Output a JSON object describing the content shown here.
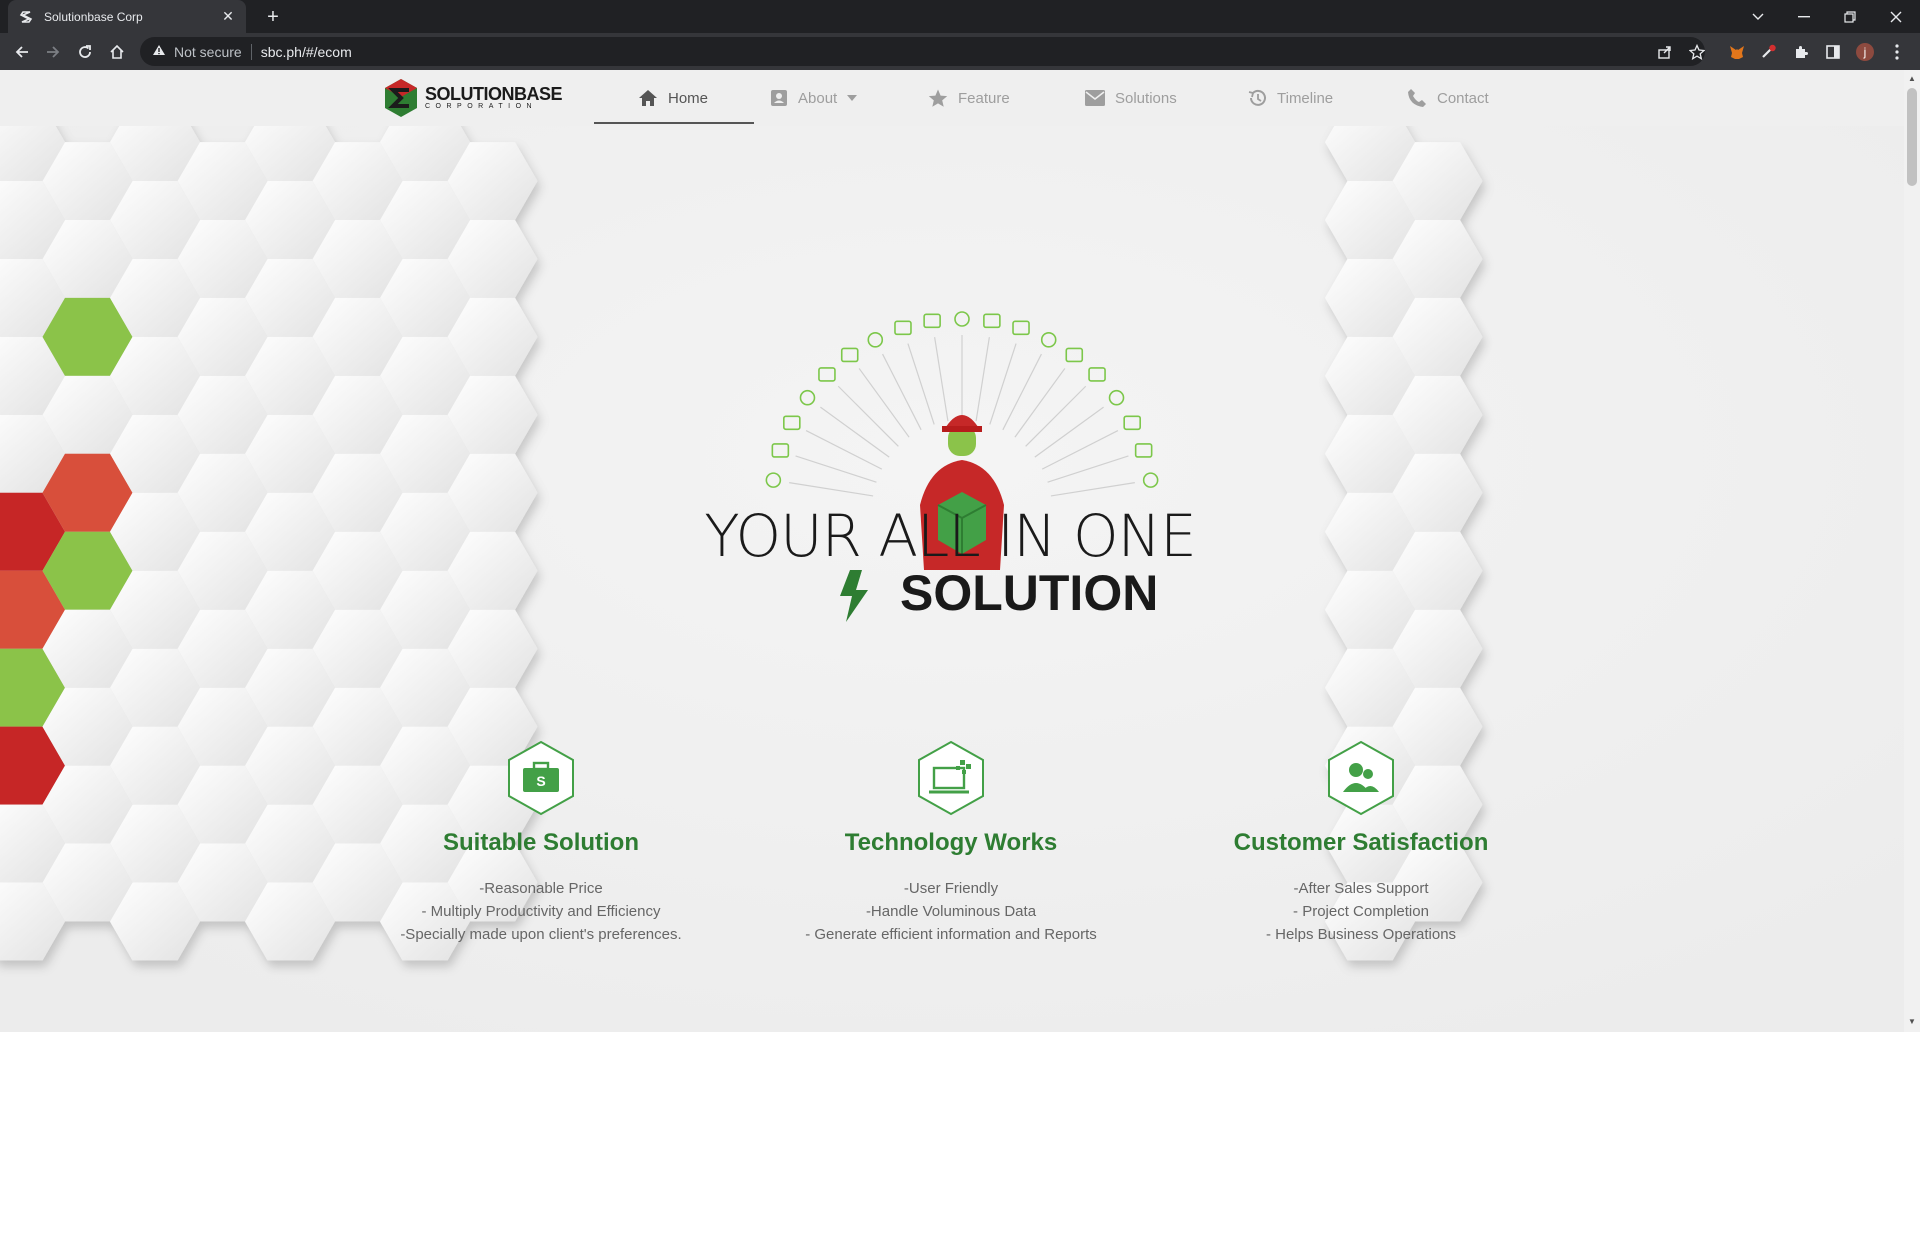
{
  "browser": {
    "tab_title": "Solutionbase Corp",
    "tab_close": "✕",
    "new_tab": "+",
    "security_label": "Not secure",
    "url": "sbc.ph/#/ecom",
    "profile_initial": "j"
  },
  "nav": {
    "logo_brand": "SOLUTIONBASE",
    "logo_sub": "CORPORATION",
    "items": [
      {
        "label": "Home"
      },
      {
        "label": "About"
      },
      {
        "label": "Feature"
      },
      {
        "label": "Solutions"
      },
      {
        "label": "Timeline"
      },
      {
        "label": "Contact"
      }
    ]
  },
  "hero": {
    "line1": "YOUR ALL IN ONE",
    "line2": "SOLUTION"
  },
  "features": [
    {
      "title": "Suitable Solution",
      "lines": [
        "-Reasonable Price",
        "- Multiply Productivity and Efficiency",
        "-Specially made upon client's preferences."
      ]
    },
    {
      "title": "Technology Works",
      "lines": [
        "-User Friendly",
        "-Handle Voluminous Data",
        "- Generate efficient information and Reports"
      ]
    },
    {
      "title": "Customer Satisfaction",
      "lines": [
        "-After Sales Support",
        "- Project Completion",
        "- Helps Business Operations"
      ]
    }
  ],
  "colors": {
    "accent_green": "#2e7d32",
    "hex_green": "#8bc34a",
    "hex_red": "#c62828",
    "hex_orange": "#d84f3a"
  }
}
